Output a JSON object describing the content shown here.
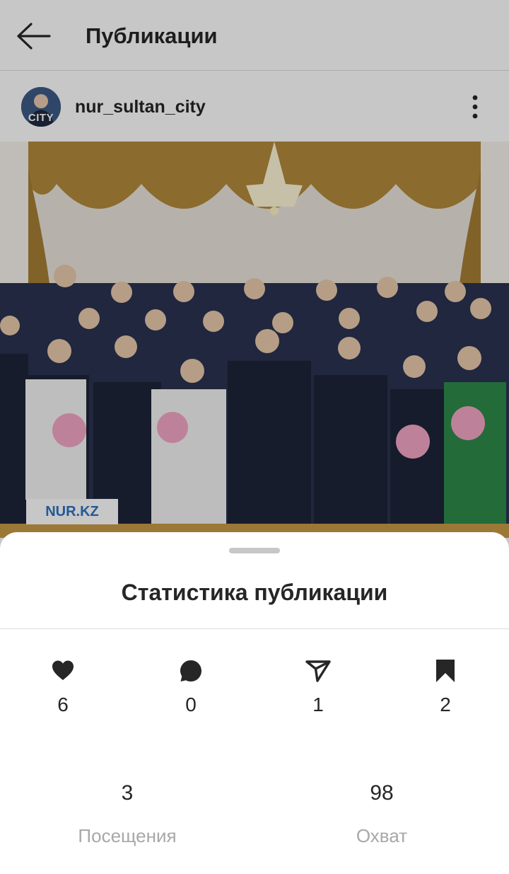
{
  "header": {
    "title": "Публикации",
    "back_icon": "arrow-left-icon"
  },
  "post": {
    "username": "nur_sultan_city",
    "avatar_text": "CITY",
    "more_icon": "more-vertical-icon",
    "watermark": "NUR.KZ"
  },
  "sheet": {
    "title": "Статистика публикации",
    "interactions": [
      {
        "icon": "heart-icon",
        "value": "6"
      },
      {
        "icon": "comment-icon",
        "value": "0"
      },
      {
        "icon": "share-icon",
        "value": "1"
      },
      {
        "icon": "bookmark-icon",
        "value": "2"
      }
    ],
    "visits": {
      "value": "3",
      "label": "Посещения"
    },
    "reach": {
      "value": "98",
      "label": "Охват"
    }
  },
  "colors": {
    "text": "#262626",
    "muted": "#a8a8a8",
    "divider": "#dbdbdb",
    "watermark": "#2d73c0"
  }
}
